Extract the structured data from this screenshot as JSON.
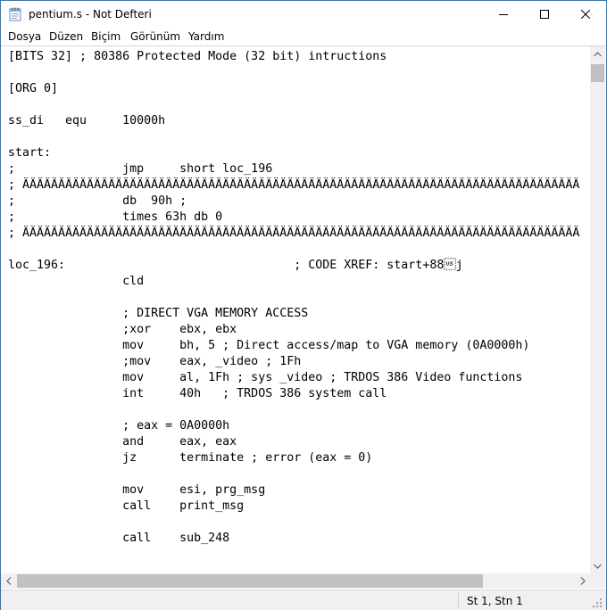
{
  "window": {
    "title": "pentium.s - Not Defteri"
  },
  "menu": {
    "items": [
      "Dosya",
      "Düzen",
      "Biçim",
      "Görünüm",
      "Yardım"
    ]
  },
  "editor": {
    "lines": [
      "[BITS 32] ; 80386 Protected Mode (32 bit) intructions",
      "",
      "[ORG 0]",
      "",
      "ss_di   equ     10000h",
      "",
      "start:",
      ";               jmp     short loc_196",
      "; ÄÄÄÄÄÄÄÄÄÄÄÄÄÄÄÄÄÄÄÄÄÄÄÄÄÄÄÄÄÄÄÄÄÄÄÄÄÄÄÄÄÄÄÄÄÄÄÄÄÄÄÄÄÄÄÄÄÄÄÄÄÄÄÄÄÄÄÄÄÄÄÄÄÄÄÄÄÄ",
      ";               db  90h ;",
      ";               times 63h db 0",
      "; ÄÄÄÄÄÄÄÄÄÄÄÄÄÄÄÄÄÄÄÄÄÄÄÄÄÄÄÄÄÄÄÄÄÄÄÄÄÄÄÄÄÄÄÄÄÄÄÄÄÄÄÄÄÄÄÄÄÄÄÄÄÄÄÄÄÄÄÄÄÄÄÄÄÄÄÄÄÄ",
      "",
      "loc_196:                                ; CODE XREF: start+88\u001fj",
      "                cld",
      "",
      "                ; DIRECT VGA MEMORY ACCESS",
      "                ;xor    ebx, ebx",
      "                mov     bh, 5 ; Direct access/map to VGA memory (0A0000h)",
      "                ;mov    eax, _video ; 1Fh",
      "                mov     al, 1Fh ; sys _video ; TRDOS 386 Video functions",
      "                int     40h   ; TRDOS 386 system call",
      "",
      "                ; eax = 0A0000h",
      "                and     eax, eax",
      "                jz      terminate ; error (eax = 0)",
      "",
      "                mov     esi, prg_msg",
      "                call    print_msg",
      "",
      "                call    sub_248",
      ""
    ]
  },
  "status": {
    "position": "St 1, Stn 1"
  },
  "colors": {
    "window_border": "#1a7ad4",
    "scrollbar_track": "#f0f0f0",
    "scrollbar_thumb": "#c1c1c1",
    "statusbar_bg": "#f0f0f0"
  },
  "icons": [
    "notepad-icon",
    "minimize-icon",
    "maximize-icon",
    "close-icon",
    "scroll-up-icon",
    "scroll-down-icon",
    "scroll-left-icon",
    "scroll-right-icon",
    "resize-grip-icon"
  ]
}
